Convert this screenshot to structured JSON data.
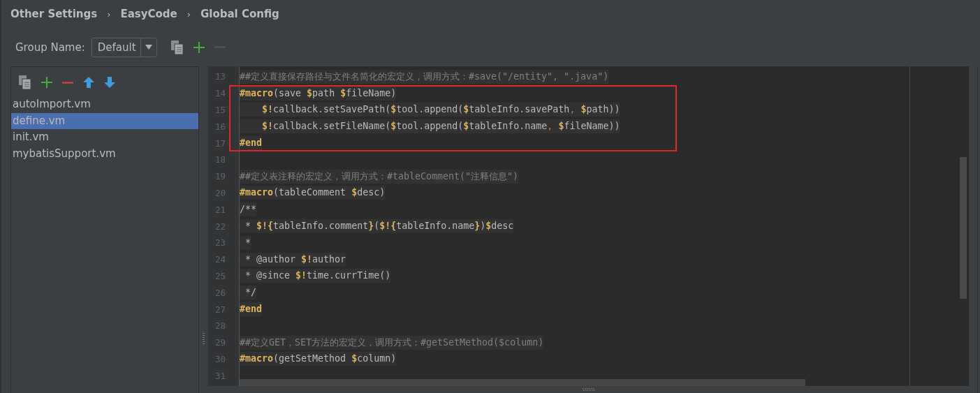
{
  "breadcrumb": {
    "separator": "›",
    "items": [
      "Other Settings",
      "EasyCode",
      "Global Config"
    ]
  },
  "group": {
    "label": "Group Name:",
    "value": "Default"
  },
  "files": [
    {
      "name": "autoImport.vm",
      "selected": false
    },
    {
      "name": "define.vm",
      "selected": true
    },
    {
      "name": "init.vm",
      "selected": false
    },
    {
      "name": "mybatisSupport.vm",
      "selected": false
    }
  ],
  "editor": {
    "lines": [
      {
        "number": "13",
        "boxed": false,
        "tokens": [
          {
            "kind": "comment",
            "text": "##定义直接保存路径与文件名简化的宏定义，调用方式：#save(\"/entity\", \".java\")"
          }
        ]
      },
      {
        "number": "14",
        "boxed": true,
        "tokens": [
          {
            "kind": "keyword",
            "text": "#macro"
          },
          {
            "kind": "plain",
            "text": "(save "
          },
          {
            "kind": "keyword",
            "text": "$"
          },
          {
            "kind": "plain",
            "text": "path "
          },
          {
            "kind": "keyword",
            "text": "$"
          },
          {
            "kind": "plain",
            "text": "fileName)"
          }
        ]
      },
      {
        "number": "15",
        "boxed": true,
        "tokens": [
          {
            "kind": "keyword",
            "text": "    $!"
          },
          {
            "kind": "plain",
            "text": "callback.setSavePath("
          },
          {
            "kind": "keyword",
            "text": "$"
          },
          {
            "kind": "plain",
            "text": "tool.append("
          },
          {
            "kind": "keyword",
            "text": "$"
          },
          {
            "kind": "plain",
            "text": "tableInfo.savePath"
          },
          {
            "kind": "comma",
            "text": ", "
          },
          {
            "kind": "keyword",
            "text": "$"
          },
          {
            "kind": "plain",
            "text": "path))"
          }
        ]
      },
      {
        "number": "16",
        "boxed": true,
        "tokens": [
          {
            "kind": "keyword",
            "text": "    $!"
          },
          {
            "kind": "plain",
            "text": "callback.setFileName("
          },
          {
            "kind": "keyword",
            "text": "$"
          },
          {
            "kind": "plain",
            "text": "tool.append("
          },
          {
            "kind": "keyword",
            "text": "$"
          },
          {
            "kind": "plain",
            "text": "tableInfo.name"
          },
          {
            "kind": "comma",
            "text": ", "
          },
          {
            "kind": "keyword",
            "text": "$"
          },
          {
            "kind": "plain",
            "text": "fileName))"
          }
        ]
      },
      {
        "number": "17",
        "boxed": true,
        "tokens": [
          {
            "kind": "keyword",
            "text": "#end"
          }
        ]
      },
      {
        "number": "18",
        "boxed": false
      },
      {
        "number": "19",
        "boxed": false,
        "tokens": [
          {
            "kind": "comment",
            "text": "##定义表注释的宏定义，调用方式：#tableComment(\"注释信息\")"
          }
        ]
      },
      {
        "number": "20",
        "boxed": false,
        "tokens": [
          {
            "kind": "keyword",
            "text": "#macro"
          },
          {
            "kind": "plain",
            "text": "(tableComment "
          },
          {
            "kind": "keyword",
            "text": "$"
          },
          {
            "kind": "plain",
            "text": "desc)"
          }
        ]
      },
      {
        "number": "21",
        "boxed": false,
        "tokens": [
          {
            "kind": "plain",
            "text": "/**"
          }
        ]
      },
      {
        "number": "22",
        "boxed": false,
        "tokens": [
          {
            "kind": "plain",
            "text": " * "
          },
          {
            "kind": "keyword",
            "text": "$!{"
          },
          {
            "kind": "plain",
            "text": "tableInfo.comment"
          },
          {
            "kind": "keyword",
            "text": "}"
          },
          {
            "kind": "plain",
            "text": "("
          },
          {
            "kind": "keyword",
            "text": "$!{"
          },
          {
            "kind": "plain",
            "text": "tableInfo.name"
          },
          {
            "kind": "keyword",
            "text": "}"
          },
          {
            "kind": "plain",
            "text": ")"
          },
          {
            "kind": "keyword",
            "text": "$"
          },
          {
            "kind": "plain",
            "text": "desc"
          }
        ]
      },
      {
        "number": "23",
        "boxed": false,
        "tokens": [
          {
            "kind": "plain",
            "text": " *"
          }
        ]
      },
      {
        "number": "24",
        "boxed": false,
        "tokens": [
          {
            "kind": "plain",
            "text": " * @author "
          },
          {
            "kind": "keyword",
            "text": "$!"
          },
          {
            "kind": "plain",
            "text": "author"
          }
        ]
      },
      {
        "number": "25",
        "boxed": false,
        "tokens": [
          {
            "kind": "plain",
            "text": " * @since "
          },
          {
            "kind": "keyword",
            "text": "$!"
          },
          {
            "kind": "plain",
            "text": "time.currTime()"
          }
        ]
      },
      {
        "number": "26",
        "boxed": false,
        "tokens": [
          {
            "kind": "plain",
            "text": " */"
          }
        ]
      },
      {
        "number": "27",
        "boxed": false,
        "tokens": [
          {
            "kind": "keyword",
            "text": "#end"
          }
        ]
      },
      {
        "number": "28",
        "boxed": false
      },
      {
        "number": "29",
        "boxed": false,
        "tokens": [
          {
            "kind": "comment",
            "text": "##定义GET，SET方法的宏定义，调用方式：#getSetMethod($column)"
          }
        ]
      },
      {
        "number": "30",
        "boxed": false,
        "tokens": [
          {
            "kind": "keyword",
            "text": "#macro"
          },
          {
            "kind": "plain",
            "text": "(getSetMethod "
          },
          {
            "kind": "keyword",
            "text": "$"
          },
          {
            "kind": "plain",
            "text": "column)"
          }
        ]
      },
      {
        "number": "31",
        "boxed": false
      }
    ]
  }
}
